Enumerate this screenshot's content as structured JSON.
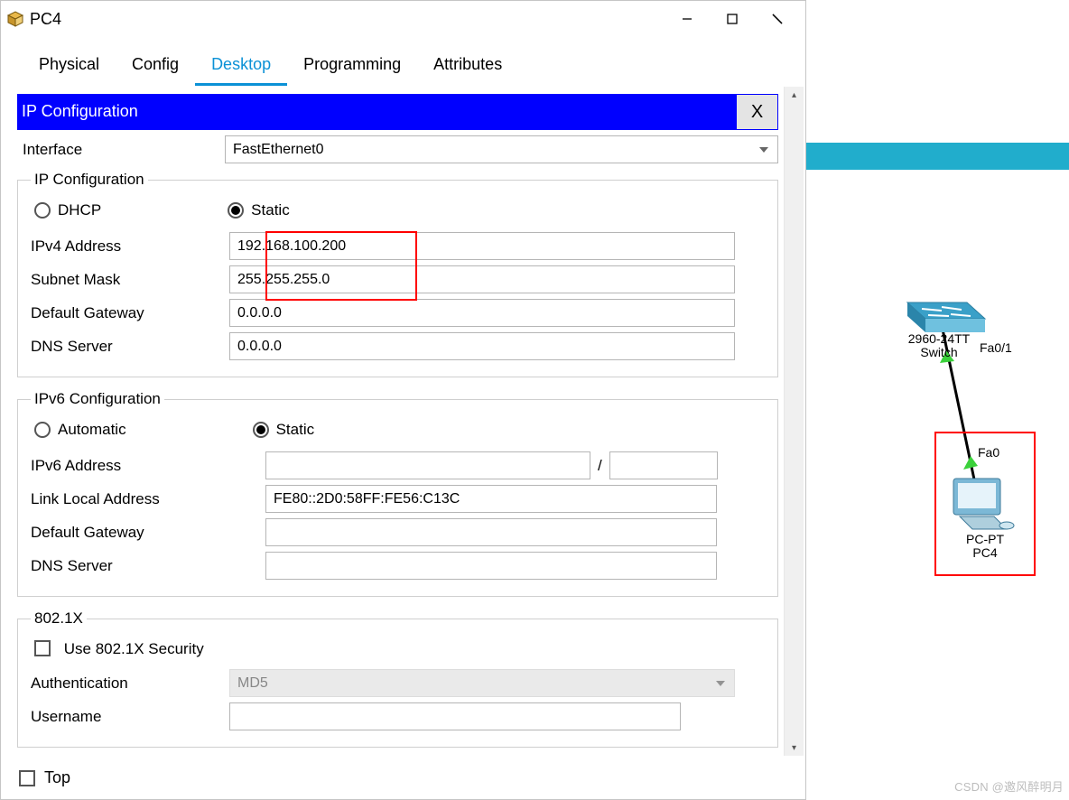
{
  "window": {
    "title": "PC4",
    "tabs": [
      "Physical",
      "Config",
      "Desktop",
      "Programming",
      "Attributes"
    ],
    "active_tab_index": 2
  },
  "panel": {
    "title": "IP Configuration",
    "close": "X"
  },
  "interface": {
    "label": "Interface",
    "value": "FastEthernet0"
  },
  "ipv4": {
    "legend": "IP Configuration",
    "mode_dhcp": "DHCP",
    "mode_static": "Static",
    "selected": "static",
    "addr_label": "IPv4 Address",
    "addr_value": "192.168.100.200",
    "mask_label": "Subnet Mask",
    "mask_value": "255.255.255.0",
    "gw_label": "Default Gateway",
    "gw_value": "0.0.0.0",
    "dns_label": "DNS Server",
    "dns_value": "0.0.0.0"
  },
  "ipv6": {
    "legend": "IPv6 Configuration",
    "mode_auto": "Automatic",
    "mode_static": "Static",
    "selected": "static",
    "addr_label": "IPv6 Address",
    "addr_value": "",
    "prefix_sep": "/",
    "prefix_value": "",
    "linklocal_label": "Link Local Address",
    "linklocal_value": "FE80::2D0:58FF:FE56:C13C",
    "gw_label": "Default Gateway",
    "gw_value": "",
    "dns_label": "DNS Server",
    "dns_value": ""
  },
  "dot1x": {
    "legend": "802.1X",
    "use_label": "Use 802.1X Security",
    "checked": false,
    "auth_label": "Authentication",
    "auth_value": "MD5",
    "user_label": "Username",
    "user_value": ""
  },
  "bottom": {
    "top_label": "Top",
    "top_checked": false
  },
  "topology": {
    "switch_name": "2960-24TT",
    "switch_sub": "Switch",
    "switch_port": "Fa0/1",
    "pc_type": "PC-PT",
    "pc_name": "PC4",
    "pc_port": "Fa0"
  },
  "watermark": "CSDN @邀风醉明月"
}
